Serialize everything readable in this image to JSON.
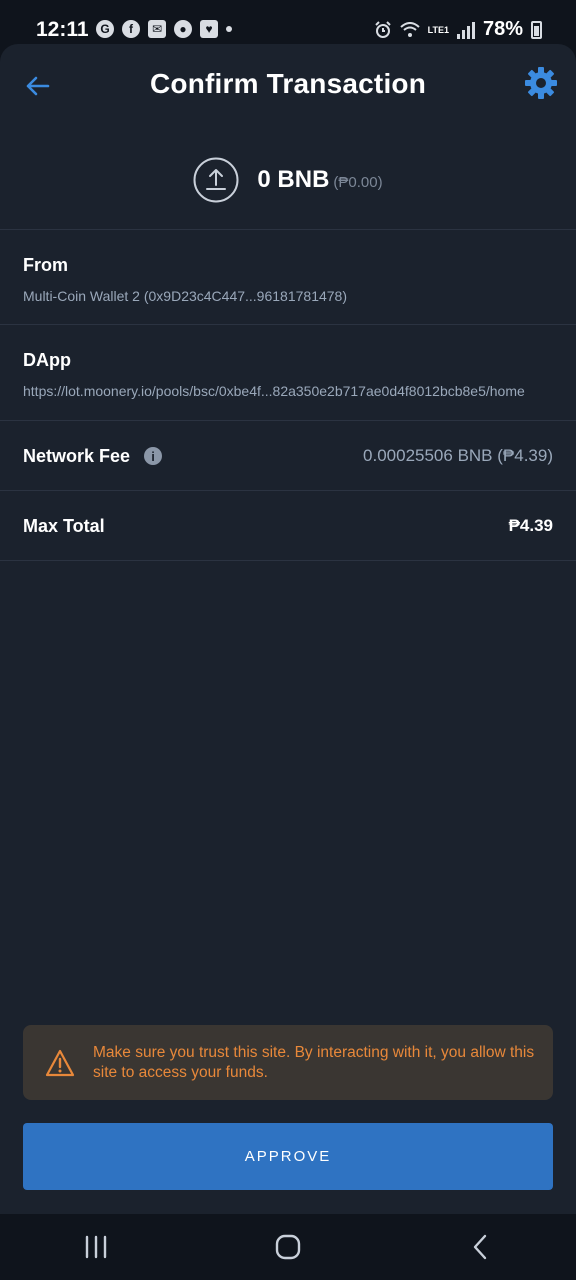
{
  "status_bar": {
    "time": "12:11",
    "battery": "78%",
    "network": "LTE1",
    "left_icons": [
      "g-icon",
      "facebook-icon",
      "mail-icon",
      "panda-icon",
      "laz-icon"
    ],
    "right_icons": [
      "alarm-icon",
      "wifi-icon",
      "signal-icon",
      "battery-icon"
    ]
  },
  "header": {
    "title": "Confirm Transaction",
    "back_icon": "arrow-left-icon",
    "settings_icon": "gear-icon"
  },
  "amount": {
    "value": "0 BNB",
    "fiat": "(₱0.00)",
    "icon": "upload-icon"
  },
  "from": {
    "label": "From",
    "value": "Multi-Coin Wallet 2 (0x9D23c4C447...96181781478)"
  },
  "dapp": {
    "label": "DApp",
    "value": "https://lot.moonery.io/pools/bsc/0xbe4f...82a350e2b717ae0d4f8012bcb8e5/home"
  },
  "network_fee": {
    "label": "Network Fee",
    "value": "0.00025506 BNB (₱4.39)",
    "info_icon": "info-icon"
  },
  "max_total": {
    "label": "Max Total",
    "value": "₱4.39"
  },
  "warning": {
    "text": "Make sure you trust this site. By interacting with it, you allow this site to access your funds.",
    "icon": "warning-icon"
  },
  "approve_button": {
    "label": "APPROVE"
  },
  "nav_bar": {
    "items": [
      "recents-icon",
      "home-icon",
      "back-icon"
    ]
  },
  "colors": {
    "background": "#1b222d",
    "accent": "#2f73c2",
    "warning": "#e8883a",
    "muted_text": "#9aa8ba"
  }
}
